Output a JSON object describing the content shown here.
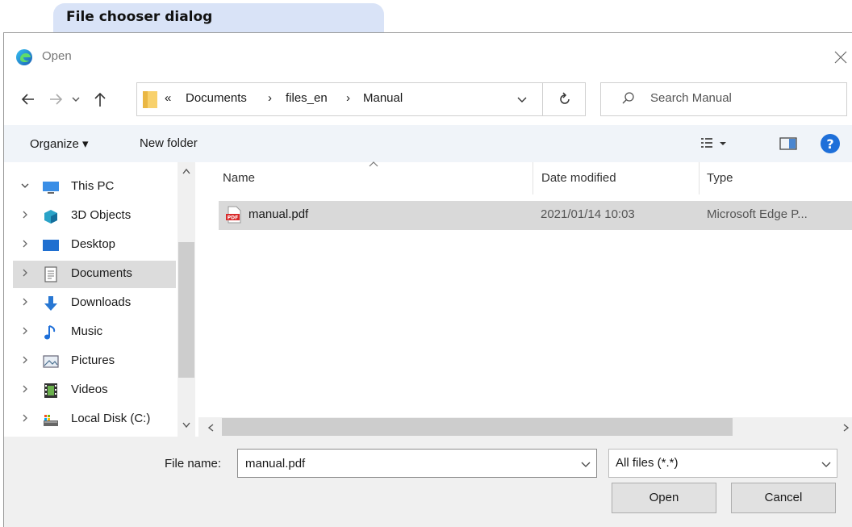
{
  "caption": "File chooser dialog",
  "window": {
    "title": "Open"
  },
  "address": {
    "overflow_glyph": "«",
    "separator": "›",
    "crumbs": [
      "Documents",
      "files_en",
      "Manual"
    ]
  },
  "search": {
    "placeholder": "Search Manual"
  },
  "toolbar": {
    "organize_label": "Organize ▾",
    "new_folder_label": "New folder"
  },
  "nav": {
    "items": [
      {
        "label": "This PC",
        "icon": "monitor-icon",
        "expanded": true
      },
      {
        "label": "3D Objects",
        "icon": "cube-icon"
      },
      {
        "label": "Desktop",
        "icon": "desktop-icon"
      },
      {
        "label": "Documents",
        "icon": "document-icon",
        "selected": true
      },
      {
        "label": "Downloads",
        "icon": "download-arrow-icon"
      },
      {
        "label": "Music",
        "icon": "music-note-icon"
      },
      {
        "label": "Pictures",
        "icon": "picture-icon"
      },
      {
        "label": "Videos",
        "icon": "film-icon"
      },
      {
        "label": "Local Disk (C:)",
        "icon": "drive-icon"
      }
    ]
  },
  "columns": {
    "name": "Name",
    "date": "Date modified",
    "type": "Type"
  },
  "files": [
    {
      "name": "manual.pdf",
      "date": "2021/01/14 10:03",
      "type": "Microsoft Edge P..."
    }
  ],
  "footer": {
    "filename_label": "File name:",
    "filename_value": "manual.pdf",
    "filetype_value": "All files (*.*)",
    "open_label": "Open",
    "cancel_label": "Cancel"
  },
  "colors": {
    "accent": "#1e6fd9",
    "selection": "#d9d9d9",
    "toolbar_bg": "#f0f4f9",
    "caption_bg": "#d9e3f7"
  }
}
